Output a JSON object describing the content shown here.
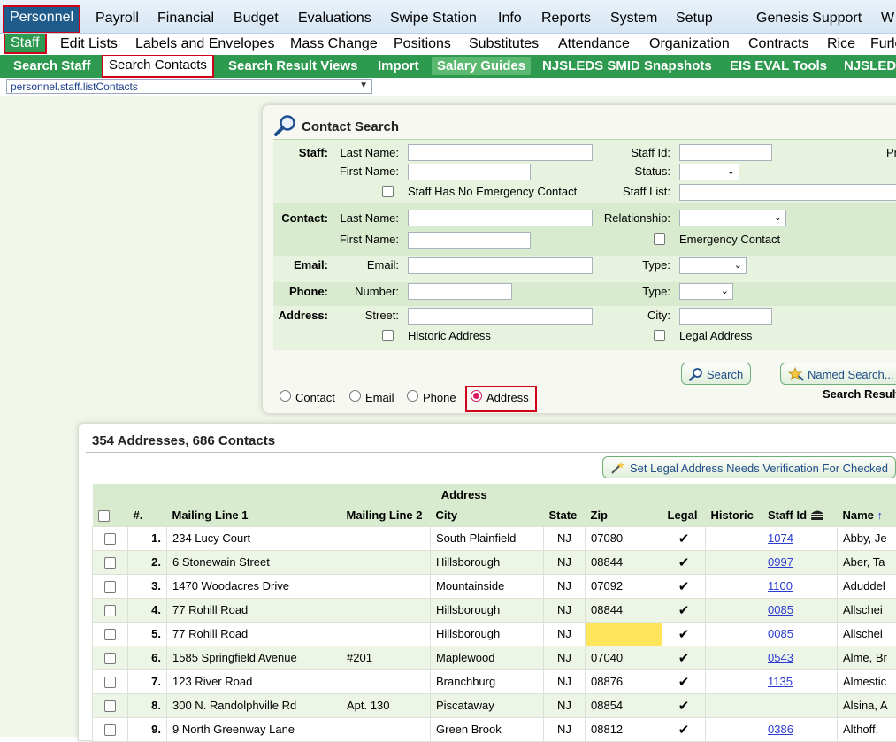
{
  "nav_main": {
    "items": [
      "Personnel",
      "Payroll",
      "Financial",
      "Budget",
      "Evaluations",
      "Swipe Station",
      "Info",
      "Reports",
      "System",
      "Setup",
      "Genesis Support",
      "W"
    ]
  },
  "nav_sub": {
    "items": [
      "Staff",
      "Edit Lists",
      "Labels and Envelopes",
      "Mass Change",
      "Positions",
      "Substitutes",
      "Attendance",
      "Organization",
      "Contracts",
      "Rice",
      "Furlo"
    ]
  },
  "nav_tabs": {
    "items": [
      "Search Staff",
      "Search Contacts",
      "Search Result Views",
      "Import",
      "Salary Guides",
      "NJSLEDS SMID Snapshots",
      "EIS EVAL Tools",
      "NJSLED"
    ]
  },
  "route_select": {
    "value": "personnel.staff.listContacts"
  },
  "search_panel": {
    "title": "Contact Search",
    "staff_section": "Staff:",
    "contact_section": "Contact:",
    "email_section": "Email:",
    "phone_section": "Phone:",
    "address_section": "Address:",
    "last_name": "Last Name:",
    "first_name": "First Name:",
    "staff_no_emergency": "Staff Has No Emergency Contact",
    "staff_id": "Staff Id:",
    "status": "Status:",
    "staff_list": "Staff List:",
    "pr_cut": "Pr",
    "relationship": "Relationship:",
    "emergency_contact": "Emergency Contact",
    "email_label": "Email:",
    "type_label": "Type:",
    "number_label": "Number:",
    "street_label": "Street:",
    "city_label": "City:",
    "historic_address": "Historic Address",
    "legal_address": "Legal Address",
    "search_button": "Search",
    "named_search_button": "Named Search...",
    "search_results_label": "Search Result",
    "radio_options": [
      "Contact",
      "Email",
      "Phone",
      "Address"
    ],
    "radio_selected": "Address"
  },
  "results": {
    "title": "354 Addresses, 686 Contacts",
    "verify_button": "Set Legal Address Needs Verification For Checked",
    "group_header": "Address",
    "columns": [
      "#.",
      "Mailing Line 1",
      "Mailing Line 2",
      "City",
      "State",
      "Zip",
      "Legal",
      "Historic",
      "Staff Id",
      "Name"
    ],
    "rows": [
      {
        "n": "1.",
        "line1": "234 Lucy Court",
        "line2": "",
        "city": "South Plainfield",
        "state": "NJ",
        "zip": "07080",
        "legal": "✔",
        "historic": "",
        "staff_id": "1074",
        "name": "Abby, Je"
      },
      {
        "n": "2.",
        "line1": "6 Stonewain Street",
        "line2": "",
        "city": "Hillsborough",
        "state": "NJ",
        "zip": "08844",
        "legal": "✔",
        "historic": "",
        "staff_id": "0997",
        "name": "Aber, Ta"
      },
      {
        "n": "3.",
        "line1": "1470 Woodacres Drive",
        "line2": "",
        "city": "Mountainside",
        "state": "NJ",
        "zip": "07092",
        "legal": "✔",
        "historic": "",
        "staff_id": "1100",
        "name": "Aduddel"
      },
      {
        "n": "4.",
        "line1": "77 Rohill Road",
        "line2": "",
        "city": "Hillsborough",
        "state": "NJ",
        "zip": "08844",
        "legal": "✔",
        "historic": "",
        "staff_id": "0085",
        "name": "Allschei"
      },
      {
        "n": "5.",
        "line1": "77 Rohill Road",
        "line2": "",
        "city": "Hillsborough",
        "state": "NJ",
        "zip": "",
        "legal": "✔",
        "historic": "",
        "staff_id": "0085",
        "name": "Allschei"
      },
      {
        "n": "6.",
        "line1": "1585 Springfield Avenue",
        "line2": "#201",
        "city": "Maplewood",
        "state": "NJ",
        "zip": "07040",
        "legal": "✔",
        "historic": "",
        "staff_id": "0543",
        "name": "Alme, Br"
      },
      {
        "n": "7.",
        "line1": "123 River Road",
        "line2": "",
        "city": "Branchburg",
        "state": "NJ",
        "zip": "08876",
        "legal": "✔",
        "historic": "",
        "staff_id": "1135",
        "name": "Almestic"
      },
      {
        "n": "8.",
        "line1": "300 N. Randolphville Rd",
        "line2": "Apt. 130",
        "city": "Piscataway",
        "state": "NJ",
        "zip": "08854",
        "legal": "✔",
        "historic": "",
        "staff_id": "",
        "name": "Alsina, A"
      },
      {
        "n": "9.",
        "line1": "9 North Greenway Lane",
        "line2": "",
        "city": "Green Brook",
        "state": "NJ",
        "zip": "08812",
        "legal": "✔",
        "historic": "",
        "staff_id": "0386",
        "name": "Althoff,"
      }
    ]
  },
  "colors": {
    "nav_green": "#2e9a4f",
    "active_blue": "#1f5c8c",
    "highlight_red": "#d0021b",
    "row_green": "#edf5e7",
    "warn_yellow": "#ffe55c"
  }
}
